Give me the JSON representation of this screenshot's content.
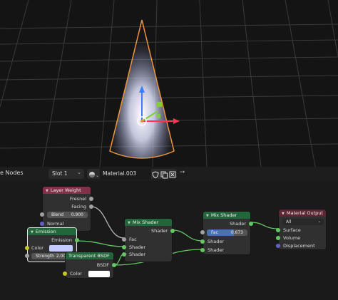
{
  "viewport": {
    "selection_color": "#f0953c",
    "grid_color": "#3a3a3a",
    "icons": [
      "x-axis-arrow-icon",
      "y-axis-arrow-icon",
      "z-axis-arrow-icon",
      "object-origin-icon",
      "scale-handle-icon"
    ]
  },
  "header": {
    "editor_title": "e Nodes",
    "slot_value": "Slot 1",
    "material_name": "Material.003"
  },
  "nodes": {
    "layer_weight": {
      "title": "Layer Weight",
      "out_fresnel": "Fresnel",
      "out_facing": "Facing",
      "blend_label": "Blend",
      "blend_value": "0.900",
      "in_normal": "Normal"
    },
    "emission": {
      "title": "Emission",
      "out_emission": "Emission",
      "color_label": "Color",
      "color_value": "#c5cbff",
      "strength_label": "Strength",
      "strength_value": "2.000"
    },
    "transparent": {
      "title": "Transparent BSDF",
      "out_bsdf": "BSDF",
      "color_label": "Color",
      "color_value": "#ffffff"
    },
    "mix1": {
      "title": "Mix Shader",
      "out_shader": "Shader",
      "in_fac": "Fac",
      "in_shader1": "Shader",
      "in_shader2": "Shader"
    },
    "mix2": {
      "title": "Mix Shader",
      "out_shader": "Shader",
      "fac_label": "Fac",
      "fac_value": "0.673",
      "fac_fraction": 0.673,
      "in_shader1": "Shader",
      "in_shader2": "Shader"
    },
    "output": {
      "title": "Material Output",
      "target": "All",
      "in_surface": "Surface",
      "in_volume": "Volume",
      "in_displacement": "Displacement"
    }
  },
  "colors": {
    "input_header": "#83314a",
    "shader_header": "#24663b",
    "output_header": "#5e2634",
    "shader_socket": "#63c763",
    "float_socket": "#a1a1a1",
    "color_socket": "#c7c729",
    "vector_socket": "#6363c7",
    "fac_fill": "#4772b3"
  }
}
